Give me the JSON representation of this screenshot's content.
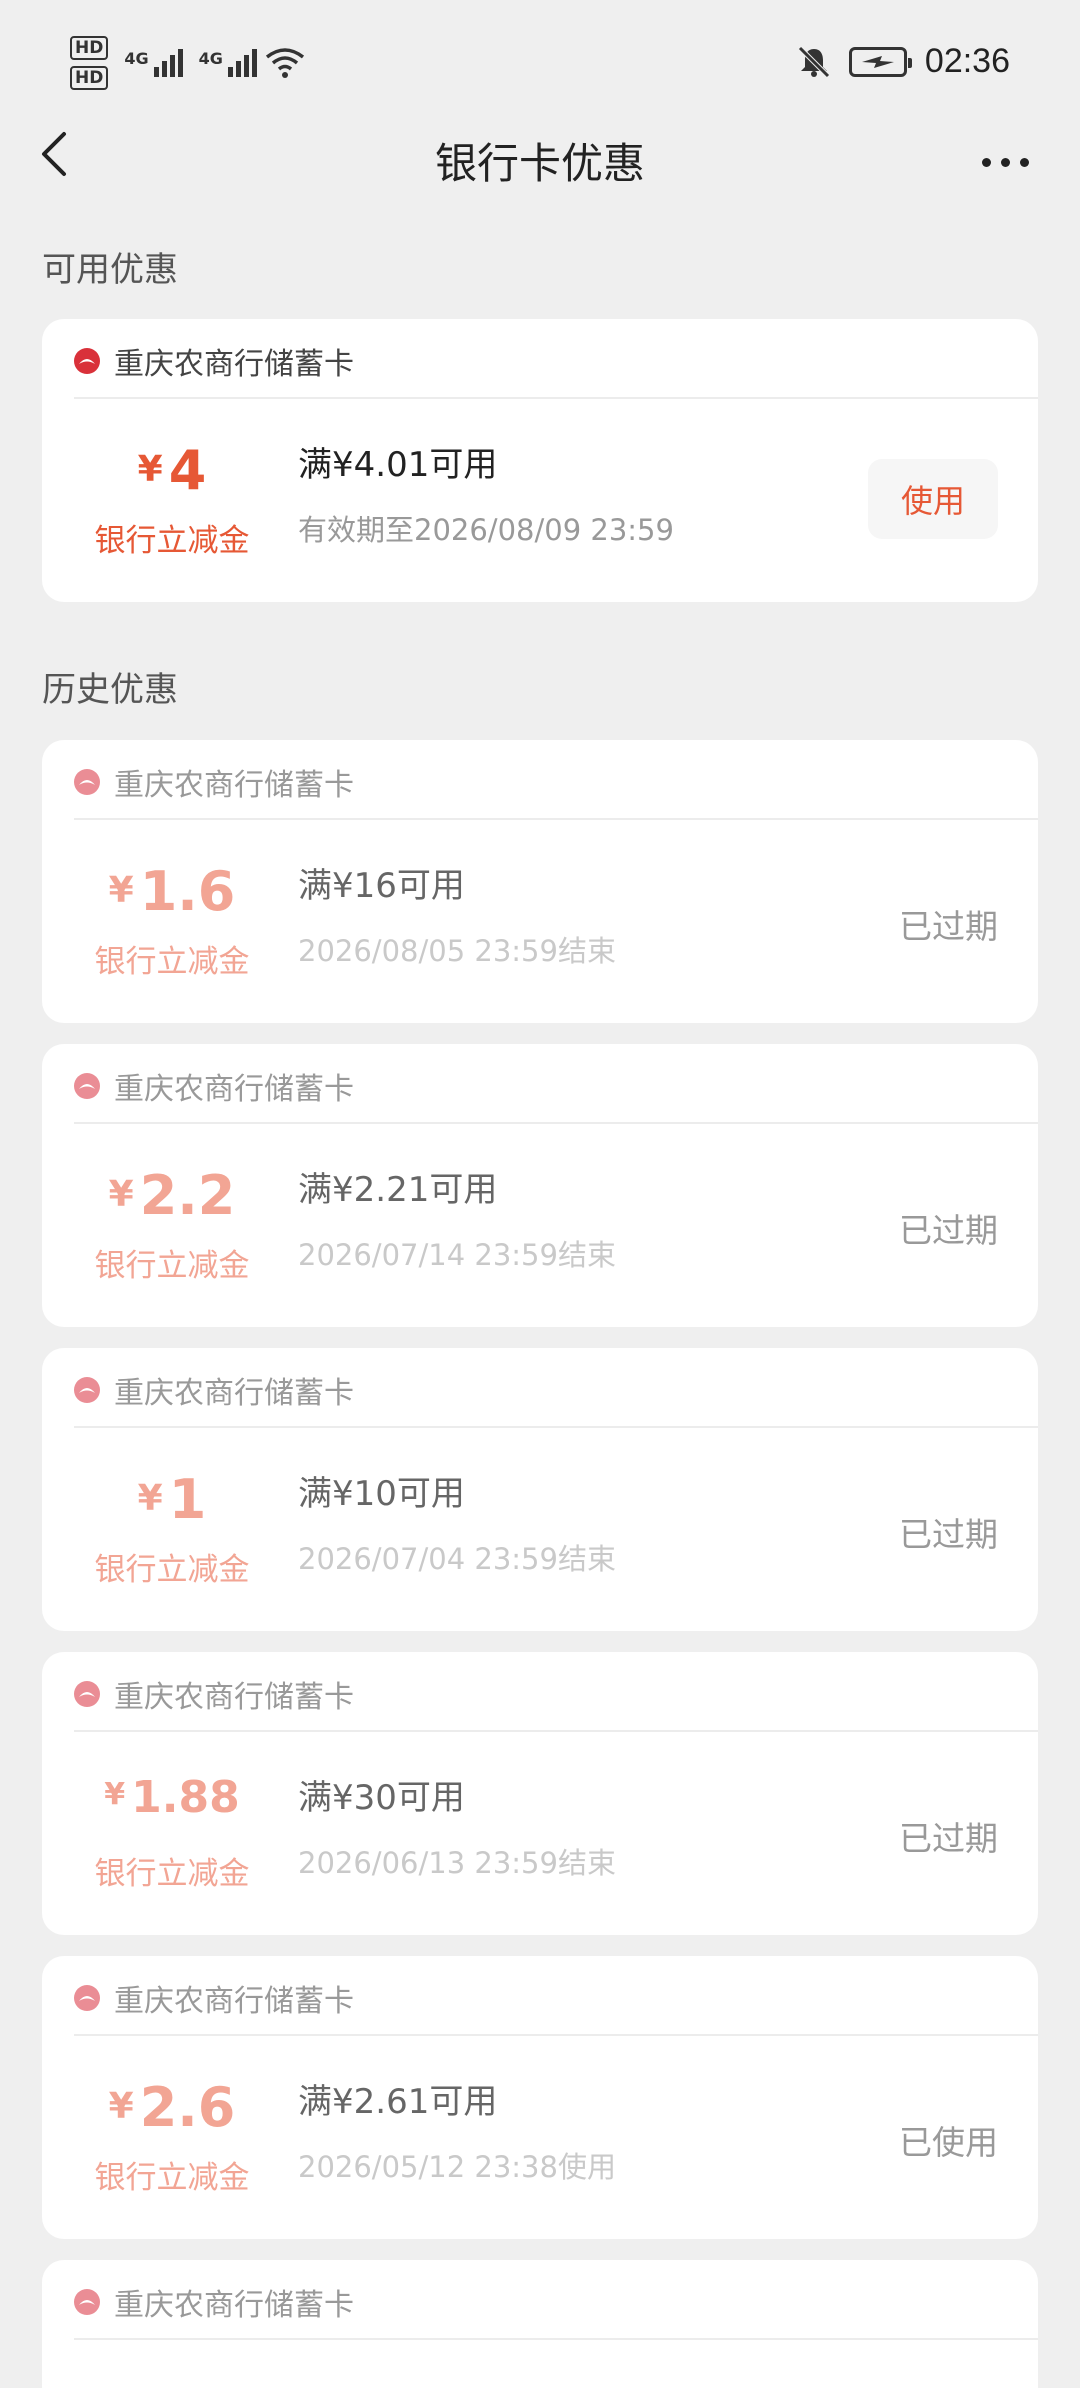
{
  "status_bar": {
    "hd1": "HD",
    "hd2": "HD",
    "net1": "4G",
    "net2": "4G",
    "time": "02:36"
  },
  "nav": {
    "title": "银行卡优惠"
  },
  "available_title": "可用优惠",
  "history_title": "历史优惠",
  "available": {
    "bank": "重庆农商行储蓄卡",
    "yen": "¥",
    "amount": "4",
    "amount_label": "银行立减金",
    "condition": "满¥4.01可用",
    "validity": "有效期至2026/08/09 23:59",
    "action": "使用"
  },
  "history": [
    {
      "bank": "重庆农商行储蓄卡",
      "yen": "¥",
      "amount": "1.6",
      "amount_label": "银行立减金",
      "condition": "满¥16可用",
      "validity": "2026/08/05 23:59结束",
      "status": "已过期"
    },
    {
      "bank": "重庆农商行储蓄卡",
      "yen": "¥",
      "amount": "2.2",
      "amount_label": "银行立减金",
      "condition": "满¥2.21可用",
      "validity": "2026/07/14 23:59结束",
      "status": "已过期"
    },
    {
      "bank": "重庆农商行储蓄卡",
      "yen": "¥",
      "amount": "1",
      "amount_label": "银行立减金",
      "condition": "满¥10可用",
      "validity": "2026/07/04 23:59结束",
      "status": "已过期"
    },
    {
      "bank": "重庆农商行储蓄卡",
      "yen": "¥",
      "amount": "1.88",
      "amount_label": "银行立减金",
      "condition": "满¥30可用",
      "validity": "2026/06/13 23:59结束",
      "status": "已过期"
    },
    {
      "bank": "重庆农商行储蓄卡",
      "yen": "¥",
      "amount": "2.6",
      "amount_label": "银行立减金",
      "condition": "满¥2.61可用",
      "validity": "2026/05/12 23:38使用",
      "status": "已使用"
    },
    {
      "bank": "重庆农商行储蓄卡"
    }
  ],
  "colors": {
    "accent": "#e65835",
    "accent_faded": "#f2a594",
    "background": "#efefef"
  }
}
